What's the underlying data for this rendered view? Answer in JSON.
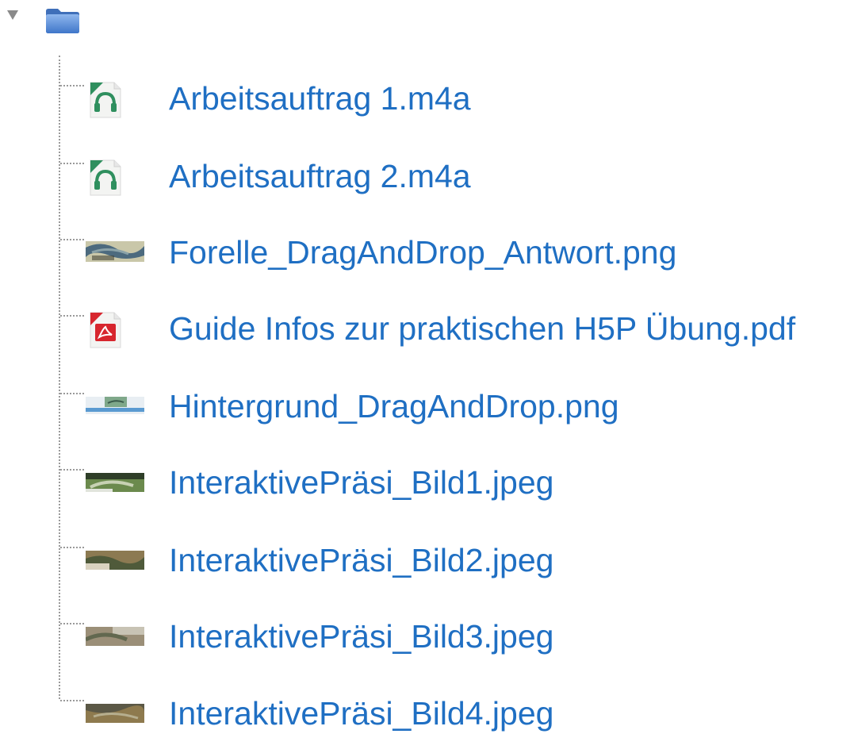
{
  "tree": {
    "root": {
      "toggle_icon": "triangle-down-icon",
      "folder_icon": "folder-icon",
      "expanded": true
    },
    "files": [
      {
        "name": "Arbeitsauftrag 1.m4a",
        "icon": "audio-file-icon"
      },
      {
        "name": "Arbeitsauftrag 2.m4a",
        "icon": "audio-file-icon"
      },
      {
        "name": "Forelle_DragAndDrop_Antwort.png",
        "icon": "image-thumbnail-icon"
      },
      {
        "name": "Guide Infos zur praktischen H5P Übung.pdf",
        "icon": "pdf-file-icon"
      },
      {
        "name": "Hintergrund_DragAndDrop.png",
        "icon": "image-thumbnail-icon"
      },
      {
        "name": "InteraktivePräsi_Bild1.jpeg",
        "icon": "image-thumbnail-icon"
      },
      {
        "name": "InteraktivePräsi_Bild2.jpeg",
        "icon": "image-thumbnail-icon"
      },
      {
        "name": "InteraktivePräsi_Bild3.jpeg",
        "icon": "image-thumbnail-icon"
      },
      {
        "name": "InteraktivePräsi_Bild4.jpeg",
        "icon": "image-thumbnail-icon"
      }
    ]
  },
  "colors": {
    "link": "#1f6fc3",
    "tree_line": "#9a9a9a",
    "folder": "#4d84d3",
    "audio_icon": "#2f8f5e",
    "pdf_icon": "#d7262e"
  }
}
